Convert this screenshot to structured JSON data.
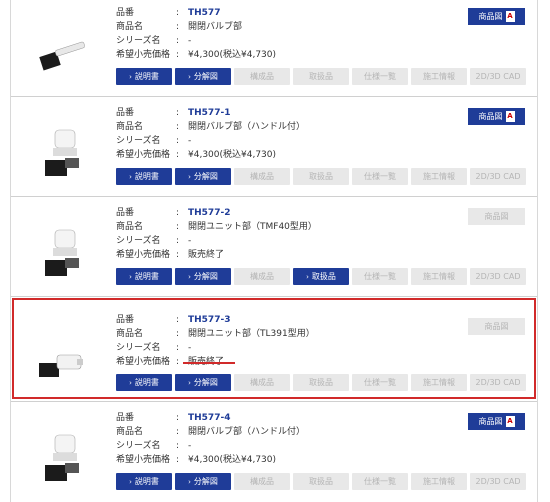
{
  "labels": {
    "code": "品番",
    "name": "商品名",
    "series": "シリーズ名",
    "price": "希望小売価格",
    "colon": ":"
  },
  "buttons": {
    "manual": "説明書",
    "exploded": "分解図",
    "parts": "構成品",
    "handling": "取扱品",
    "spec": "仕様一覧",
    "install": "施工情報",
    "cad": "2D/3D CAD",
    "drawing": "商品図",
    "pdf_glyph": "A"
  },
  "products": [
    {
      "code": "TH577",
      "name": "開閉バルブ部",
      "series": "-",
      "price": "¥4,300(税込¥4,730)",
      "manual_on": true,
      "exploded_on": true,
      "handling_on": false,
      "drawing_on": true
    },
    {
      "code": "TH577-1",
      "name": "開閉バルブ部（ハンドル付）",
      "series": "-",
      "price": "¥4,300(税込¥4,730)",
      "manual_on": true,
      "exploded_on": true,
      "handling_on": false,
      "drawing_on": true
    },
    {
      "code": "TH577-2",
      "name": "開閉ユニット部（TMF40型用）",
      "series": "-",
      "price": "販売終了",
      "manual_on": true,
      "exploded_on": true,
      "handling_on": true,
      "drawing_on": false
    },
    {
      "code": "TH577-3",
      "name": "開閉ユニット部（TL391型用）",
      "series": "-",
      "price": "販売終了",
      "manual_on": true,
      "exploded_on": true,
      "handling_on": false,
      "drawing_on": false
    },
    {
      "code": "TH577-4",
      "name": "開閉バルブ部（ハンドル付）",
      "series": "-",
      "price": "¥4,300(税込¥4,730)",
      "manual_on": true,
      "exploded_on": true,
      "handling_on": false,
      "drawing_on": true
    }
  ],
  "colors": {
    "accent": "#1f3c98",
    "disabled_bg": "#e8e8e8",
    "highlight": "#d12a2a"
  }
}
